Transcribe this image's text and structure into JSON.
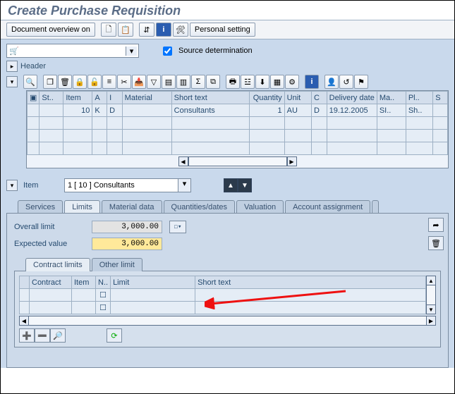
{
  "title": "Create Purchase Requisition",
  "main_toolbar": {
    "doc_overview": "Document overview on",
    "personal_setting": "Personal setting"
  },
  "source_det": {
    "label": "Source determination",
    "checked": true
  },
  "header_label": "Header",
  "item_section": {
    "label": "Item",
    "selected": "1 [ 10 ] Consultants"
  },
  "tabs": [
    "Services",
    "Limits",
    "Material data",
    "Quantities/dates",
    "Valuation",
    "Account assignment"
  ],
  "active_tab": "Limits",
  "limits": {
    "overall_limit_label": "Overall limit",
    "overall_limit_value": "3,000.00",
    "expected_value_label": "Expected value",
    "expected_value_value": "3,000.00"
  },
  "inner_tabs": [
    "Contract limits",
    "Other limit"
  ],
  "contract_cols": [
    "Contract",
    "Item",
    "N..",
    "Limit",
    "Short text"
  ],
  "grid_cols": [
    "St..",
    "Item",
    "A",
    "I",
    "Material",
    "Short text",
    "Quantity",
    "Unit",
    "C",
    "Delivery date",
    "Ma..",
    "Pl..",
    "S"
  ],
  "grid_row": {
    "status": "",
    "item": "10",
    "a": "K",
    "i": "D",
    "material": "",
    "short_text": "Consultants",
    "qty": "1",
    "unit": "AU",
    "c": "D",
    "delivery": "19.12.2005",
    "ma": "SI..",
    "pl": "Sh.."
  }
}
